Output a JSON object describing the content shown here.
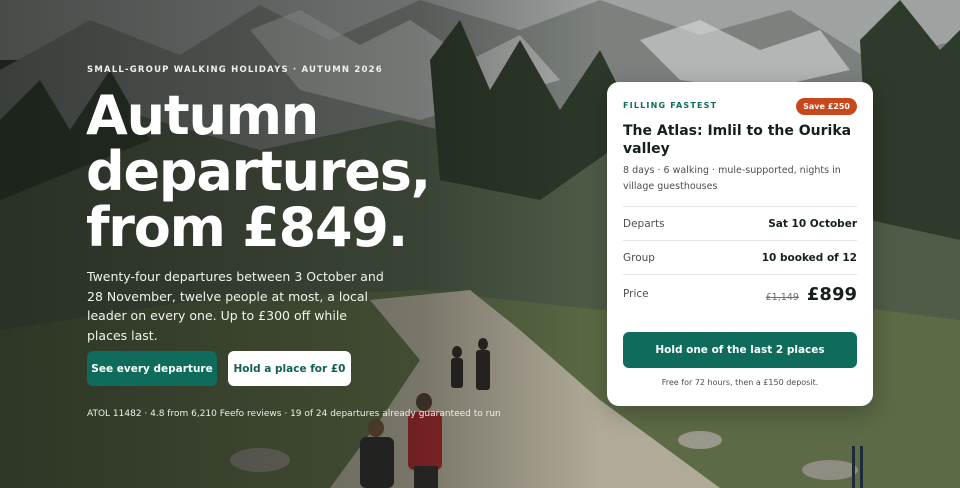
{
  "hero": {
    "eyebrow": "SMALL-GROUP WALKING HOLIDAYS · AUTUMN 2026",
    "headline": "Autumn departures, from £849.",
    "lede": "Twenty-four departures between 3 October and 28 November, twelve people at most, a local leader on every one. Up to £300 off while places last.",
    "primary_button": "See every departure",
    "secondary_button": "Hold a place for £0",
    "trust_line": "ATOL 11482 · 4.8 from 6,210 Feefo reviews · 19 of 24 departures already guaranteed to run",
    "background_image": "mountain-trail-walkers-photo"
  },
  "card": {
    "tag": "FILLING FASTEST",
    "badge": "Save £250",
    "title": "The Atlas: Imlil to the Ourika valley",
    "subtitle": "8 days · 6 walking · mule-supported, nights in village guesthouses",
    "rows": [
      {
        "label": "Departs",
        "value": "Sat 10 October"
      },
      {
        "label": "Group",
        "value": "10 booked of 12"
      }
    ],
    "price": {
      "label": "Price",
      "was": "£1,149",
      "now": "£899"
    },
    "cta": "Hold one of the last 2 places",
    "note": "Free for 72 hours, then a £150 deposit."
  },
  "colors": {
    "brand_green": "#0f6b5b",
    "badge_orange": "#c9471b",
    "text_dark": "#15201c"
  }
}
